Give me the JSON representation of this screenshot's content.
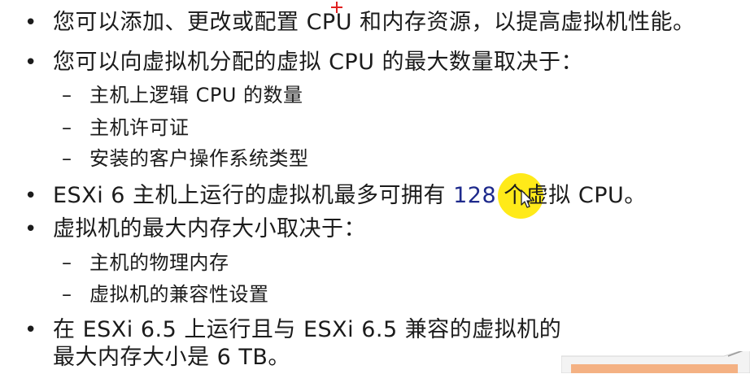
{
  "slide": {
    "bullets": [
      {
        "text": "您可以添加、更改或配置 CPU 和内存资源，以提高虚拟机性能。"
      },
      {
        "text": "您可以向虚拟机分配的虚拟 CPU 的最大数量取决于："
      },
      {
        "sub": "主机上逻辑 CPU 的数量"
      },
      {
        "sub": "主机许可证"
      },
      {
        "sub": "安装的客户操作系统类型"
      },
      {
        "text_pre": "ESXi 6 主机上运行的虚拟机最多可拥有 ",
        "highlight": "128",
        "text_post": " 个虚拟 CPU。"
      },
      {
        "text": "虚拟机的最大内存大小取决于："
      },
      {
        "sub": "主机的物理内存"
      },
      {
        "sub": "虚拟机的兼容性设置"
      },
      {
        "text": "在 ESXi 6.5 上运行且与 ESXi 6.5 兼容的虚拟机的"
      },
      {
        "text": "最大内存大小是 6 TB。"
      }
    ],
    "bullet_symbol": "•",
    "dash_symbol": "–"
  },
  "overlay": {
    "cursor_highlight_color": "#ffe800",
    "marker_color": "#e02020",
    "highlight_text_color": "#1e2a8c",
    "corner_accent_color": "#f4b183"
  }
}
